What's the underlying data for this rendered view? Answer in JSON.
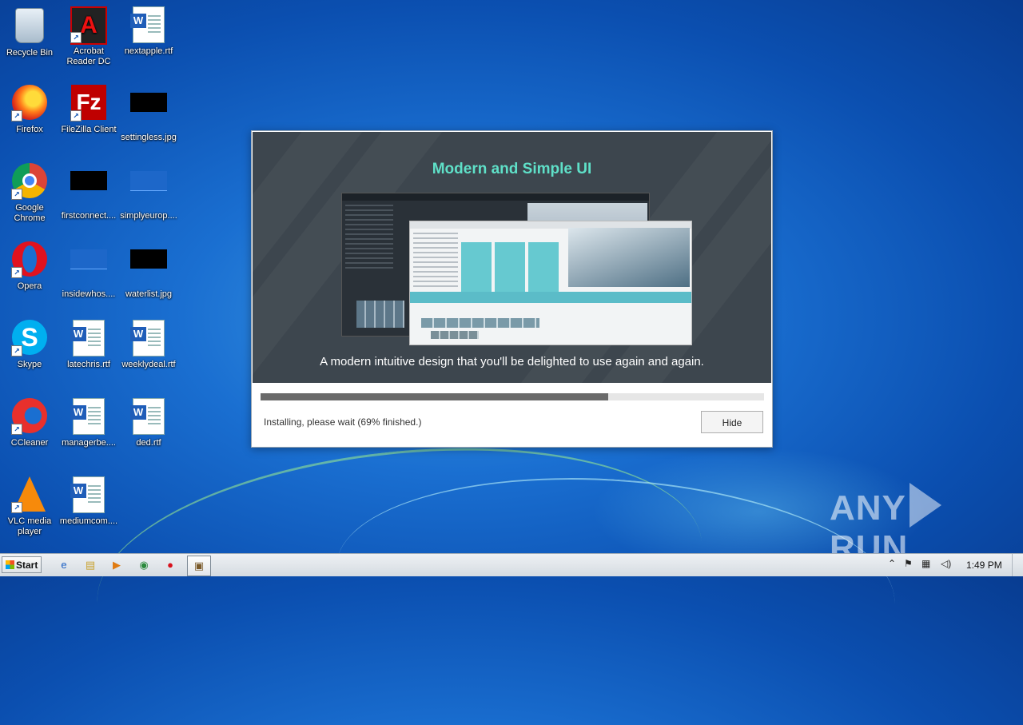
{
  "desktop": {
    "icons": [
      {
        "label": "Recycle Bin",
        "icon": "recycle-bin-icon"
      },
      {
        "label": "Acrobat Reader DC",
        "icon": "acrobat-icon"
      },
      {
        "label": "nextapple.rtf",
        "icon": "word-document-icon"
      },
      {
        "label": "Firefox",
        "icon": "firefox-icon"
      },
      {
        "label": "FileZilla Client",
        "icon": "filezilla-icon"
      },
      {
        "label": "settingless.jpg",
        "icon": "image-thumbnail-icon"
      },
      {
        "label": "Google Chrome",
        "icon": "chrome-icon"
      },
      {
        "label": "firstconnect....",
        "icon": "image-thumbnail-icon"
      },
      {
        "label": "simplyeurop....",
        "icon": "image-thumbnail-icon"
      },
      {
        "label": "Opera",
        "icon": "opera-icon"
      },
      {
        "label": "insidewhos....",
        "icon": "image-thumbnail-icon"
      },
      {
        "label": "waterlist.jpg",
        "icon": "image-thumbnail-icon"
      },
      {
        "label": "Skype",
        "icon": "skype-icon"
      },
      {
        "label": "latechris.rtf",
        "icon": "word-document-icon"
      },
      {
        "label": "weeklydeal.rtf",
        "icon": "word-document-icon"
      },
      {
        "label": "CCleaner",
        "icon": "ccleaner-icon"
      },
      {
        "label": "managerbe....",
        "icon": "word-document-icon"
      },
      {
        "label": "ded.rtf",
        "icon": "word-document-icon"
      },
      {
        "label": "VLC media player",
        "icon": "vlc-icon"
      },
      {
        "label": "mediumcom....",
        "icon": "word-document-icon"
      }
    ]
  },
  "installer": {
    "banner_title": "Modern and Simple UI",
    "banner_caption": "A modern intuitive design that you'll be delighted to use again and again.",
    "progress_percent": 69,
    "status_text": "Installing, please wait (69% finished.)",
    "hide_label": "Hide",
    "accent_color": "#5fe0c8"
  },
  "taskbar": {
    "start_label": "Start",
    "clock": "1:49 PM"
  },
  "watermark": {
    "left": "ANY",
    "right": "RUN"
  }
}
